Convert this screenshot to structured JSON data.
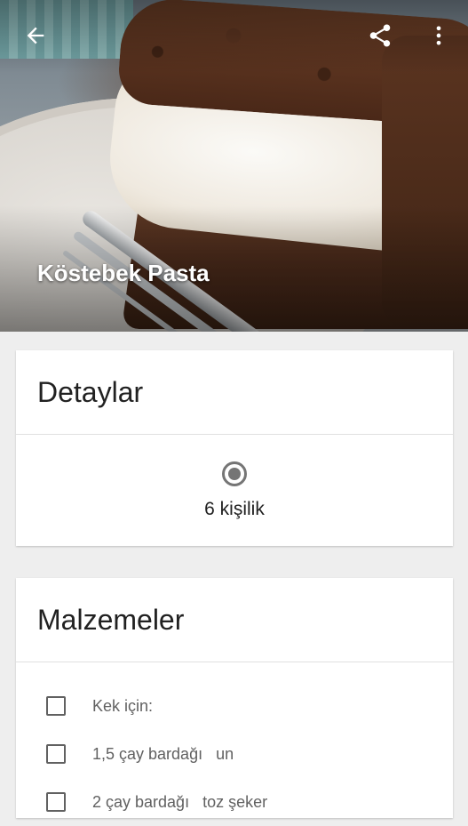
{
  "header": {
    "title": "Köstebek Pasta",
    "back_icon": "arrow-back-icon",
    "share_icon": "share-icon",
    "more_icon": "more-vert-icon"
  },
  "details_card": {
    "title": "Detaylar",
    "servings_icon": "radio-icon",
    "servings": "6 kişilik"
  },
  "ingredients_card": {
    "title": "Malzemeler",
    "items": [
      {
        "label": "Kek için:",
        "checked": false
      },
      {
        "label": "1,5 çay bardağı   un",
        "checked": false
      },
      {
        "label": "2 çay bardağı   toz şeker",
        "checked": false
      }
    ]
  },
  "colors": {
    "card_background": "#ffffff",
    "page_background": "#eeeeee",
    "title_text": "#212121",
    "secondary_text": "#616161"
  }
}
